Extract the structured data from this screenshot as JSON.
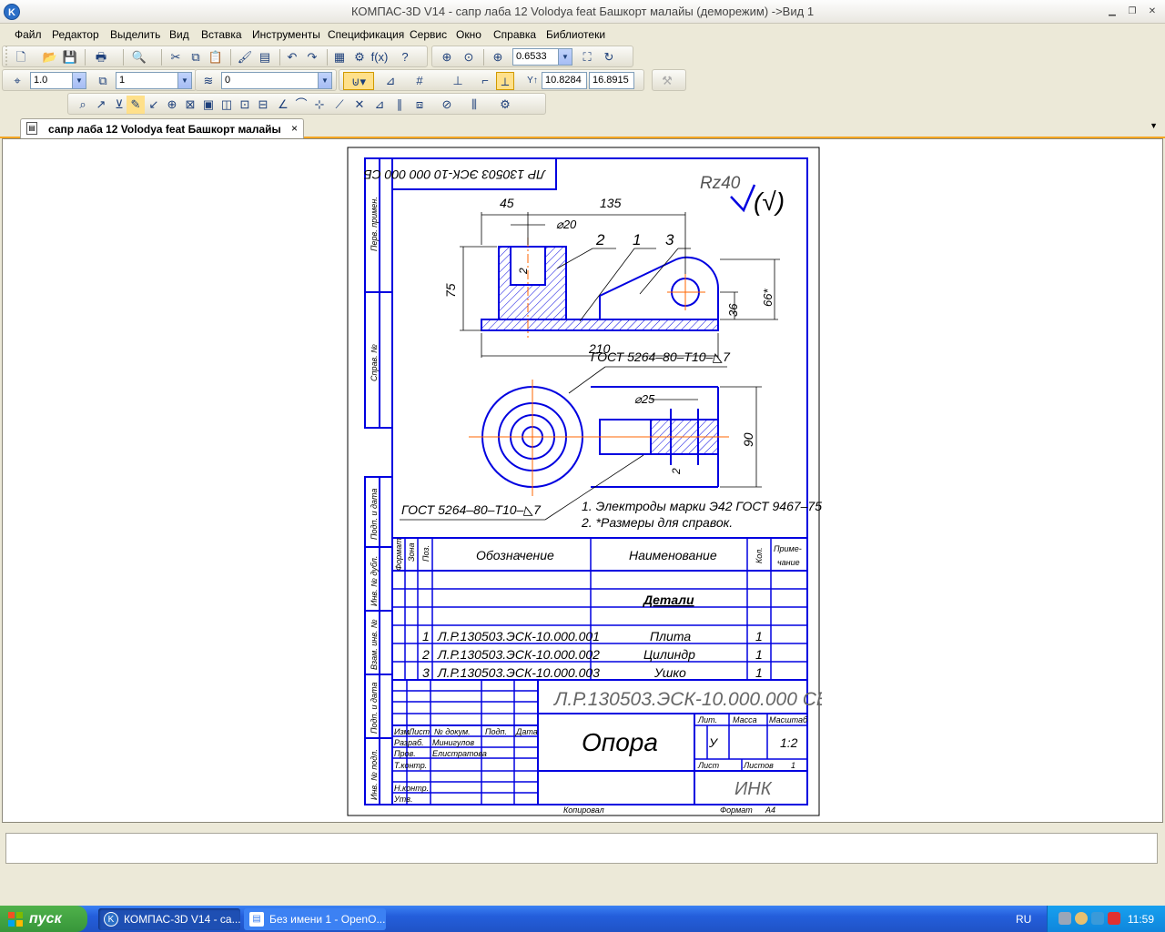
{
  "window": {
    "title": "КОМПАС-3D V14 - сапр лаба 12 Volodya feat Башкорт малайы (деморежим) ->Вид 1",
    "app_icon": "K"
  },
  "menu": [
    "Файл",
    "Редактор",
    "Выделить",
    "Вид",
    "Вставка",
    "Инструменты",
    "Спецификация",
    "Сервис",
    "Окно",
    "Справка",
    "Библиотеки"
  ],
  "toolbar": {
    "zoom_value": "0.6533",
    "step_value": "1.0",
    "layer_value": "1",
    "style_value": "0",
    "coord_x": "10.8284",
    "coord_y": "16.8915"
  },
  "document_tab": {
    "label": "сапр лаба 12 Volodya feat Башкорт малайы",
    "close": "×"
  },
  "drawing": {
    "rotated_code": "ЛР 130503 ЭСК-10 000 000 СБ",
    "roughness": "Rz40",
    "roughness_parens": "(√)",
    "dim_45": "45",
    "dim_135": "135",
    "dim_d20": "⌀20",
    "dim_75": "75",
    "dim_36": "36",
    "dim_66": "66*",
    "dim_210": "210",
    "dim_d25": "⌀25",
    "dim_90": "90",
    "pos_1": "1",
    "pos_2": "2",
    "pos_3": "3",
    "weld_top": "ГОСТ 5264–80–Т10–◺7",
    "weld_bottom": "ГОСТ 5264–80–Т10–◺7",
    "weld_mark_2": "2",
    "note_1": "1. Электроды марки Э42 ГОСТ 9467–75",
    "note_2": "2. *Размеры для справок.",
    "side_labels": [
      "Перв. примен.",
      "Справ. №",
      "Подп. и дата",
      "Инв. № дубл.",
      "Взам. инв. №",
      "Подп. и дата",
      "Инв. № подл."
    ],
    "spec_headers": {
      "format": "Формат",
      "zone": "Зона",
      "pos": "Поз.",
      "designation": "Обозначение",
      "name": "Наименование",
      "qty": "Кол.",
      "note_top": "Приме-",
      "note_bottom": "чание"
    },
    "spec_section": "Детали",
    "spec_rows": [
      {
        "pos": "1",
        "designation": "Л.Р.130503.ЭСК-10.000.001",
        "name": "Плита",
        "qty": "1"
      },
      {
        "pos": "2",
        "designation": "Л.Р.130503.ЭСК-10.000.002",
        "name": "Цилиндр",
        "qty": "1"
      },
      {
        "pos": "3",
        "designation": "Л.Р.130503.ЭСК-10.000.003",
        "name": "Ушко",
        "qty": "1"
      }
    ],
    "stamp": {
      "code": "Л.Р.130503.ЭСК-10.000.000 СБ",
      "title": "Опора",
      "lit": "Лит.",
      "mass": "Масса",
      "scale": "Масштаб",
      "lit_value": "У",
      "scale_value": "1:2",
      "sheet": "Лист",
      "sheets": "Листов",
      "sheets_value": "1",
      "org": "ИНК",
      "h_izm": "Изм.",
      "h_list": "Лист",
      "h_doc": "№ докум.",
      "h_sign": "Подп.",
      "h_date": "Дата",
      "razrab": "Разраб.",
      "razrab_name": "Минигулов",
      "prov": "Пров.",
      "prov_name": "Елистратова",
      "tkontr": "Т.контр.",
      "nkontr": "Н.контр.",
      "utv": "Утв.",
      "copied": "Копировал",
      "format": "Формат",
      "format_value": "А4"
    }
  },
  "taskbar": {
    "start": "пуск",
    "task_1": "КОМПАС-3D V14 - са...",
    "task_2": "Без имени 1 - OpenO...",
    "lang": "RU",
    "time": "11:59"
  },
  "colors": {
    "drawing_line": "#0000e0",
    "axis": "#ff6600",
    "accent_tab": "#f5a623"
  }
}
